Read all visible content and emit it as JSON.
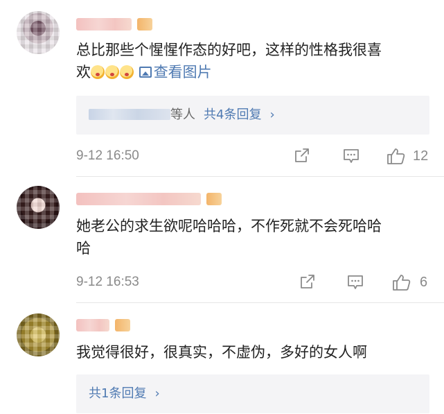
{
  "comments": [
    {
      "text_line1": "总比那些个惺惺作态的好吧，这样的性格我很喜",
      "text_line2_prefix": "欢",
      "emoji_names": [
        "blushing-emoji",
        "blushing-emoji",
        "blushing-emoji"
      ],
      "view_image_label": "查看图片",
      "reply_suffix": "等人",
      "reply_count": "共4条回复",
      "chevron": "›",
      "time": "9-12 16:50",
      "likes": "12"
    },
    {
      "text_line1": "她老公的求生欲呢哈哈哈，不作死就不会死哈哈",
      "text_line2": "哈",
      "time": "9-12 16:53",
      "likes": "6"
    },
    {
      "text_line1": "我觉得很好，很真实，不虚伪，多好的女人啊",
      "reply_count": "共1条回复",
      "chevron": "›"
    }
  ],
  "icons": [
    "share-icon",
    "comment-icon",
    "like-icon",
    "image-icon",
    "chevron-right-icon"
  ],
  "colors": {
    "link": "#4f7ab2",
    "meta": "#8a8a8a",
    "text": "#222222",
    "reply_bg": "#f4f4f6"
  }
}
